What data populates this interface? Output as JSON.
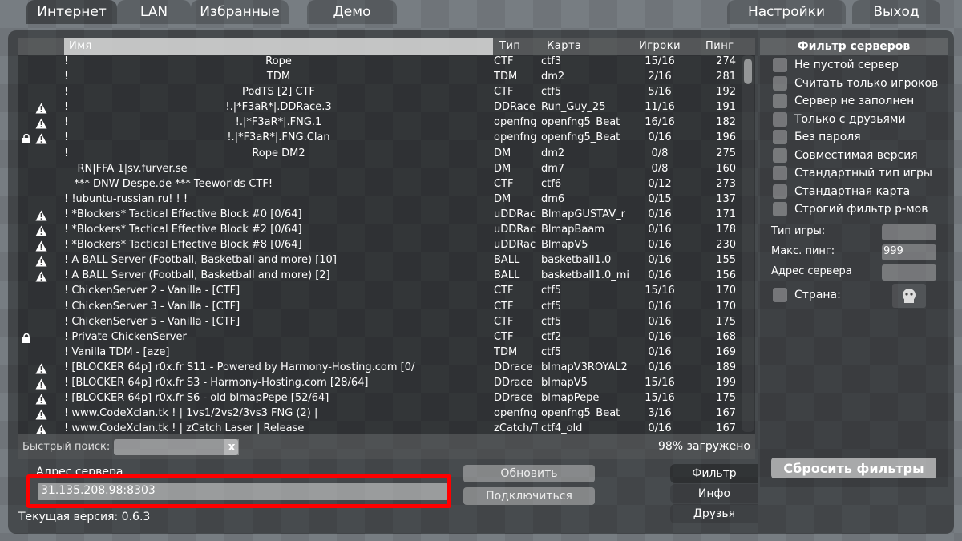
{
  "tabs": {
    "internet": "Интернет",
    "lan": "LAN",
    "favorites": "Избранные",
    "demo": "Демо",
    "settings": "Настройки",
    "quit": "Выход"
  },
  "columns": {
    "name": "Имя",
    "type": "Тип",
    "map": "Карта",
    "players": "Игроки",
    "ping": "Пинг"
  },
  "servers": [
    {
      "name": "Rope",
      "center": true,
      "type": "CTF",
      "map": "ctf3",
      "players": "15/16",
      "ping": "274",
      "lock": false,
      "warn": false
    },
    {
      "name": "TDM",
      "center": true,
      "type": "TDM",
      "map": "dm2",
      "players": "2/16",
      "ping": "281",
      "lock": false,
      "warn": false
    },
    {
      "name": "PodTS [2] CTF",
      "center": true,
      "type": "CTF",
      "map": "ctf5",
      "players": "5/16",
      "ping": "192",
      "lock": false,
      "warn": false
    },
    {
      "name": "!.|*F3aR*|.DDRace.3",
      "center": true,
      "type": "DDRace",
      "map": "Run_Guy_25",
      "players": "11/16",
      "ping": "191",
      "lock": false,
      "warn": true
    },
    {
      "name": "!.|*F3aR*|.FNG.1",
      "center": true,
      "type": "openfng",
      "map": "openfng5_Beat",
      "players": "16/16",
      "ping": "182",
      "lock": false,
      "warn": true
    },
    {
      "name": "!.|*F3aR*|.FNG.Clan",
      "center": true,
      "type": "openfng",
      "map": "openfng5_Beat",
      "players": "0/16",
      "ping": "196",
      "lock": true,
      "warn": true
    },
    {
      "name": "Rope DM2",
      "center": true,
      "type": "DM",
      "map": "dm2",
      "players": "0/8",
      "ping": "275",
      "lock": false,
      "warn": false
    },
    {
      "name": "    RN|FFA 1|sv.furver.se",
      "center": false,
      "type": "DM",
      "map": "dm7",
      "players": "0/8",
      "ping": "160",
      "lock": false,
      "warn": false
    },
    {
      "name": "   *** DNW Despe.de *** Teeworlds CTF!",
      "center": false,
      "type": "CTF",
      "map": "ctf6",
      "players": "0/12",
      "ping": "273",
      "lock": false,
      "warn": false
    },
    {
      "name": "! !ubuntu-russian.ru! ! !",
      "center": false,
      "type": "DM",
      "map": "dm6",
      "players": "0/15",
      "ping": "137",
      "lock": false,
      "warn": false
    },
    {
      "name": "! *Blockers* Tactical Effective Block #0 [0/64]",
      "center": false,
      "type": "uDDRac",
      "map": "BlmapGUSTAV_r",
      "players": "0/16",
      "ping": "171",
      "lock": false,
      "warn": true
    },
    {
      "name": "! *Blockers* Tactical Effective Block #2 [0/64]",
      "center": false,
      "type": "uDDRac",
      "map": "BlmapBaam",
      "players": "0/16",
      "ping": "178",
      "lock": false,
      "warn": true
    },
    {
      "name": "! *Blockers* Tactical Effective Block #8 [0/64]",
      "center": false,
      "type": "uDDRac",
      "map": "BlmapV5",
      "players": "0/16",
      "ping": "230",
      "lock": false,
      "warn": true
    },
    {
      "name": "! A BALL Server (Football, Basketball and more) [10]",
      "center": false,
      "type": "BALL",
      "map": "basketball1.0",
      "players": "0/16",
      "ping": "155",
      "lock": false,
      "warn": true
    },
    {
      "name": "! A BALL Server (Football, Basketball and more) [2]",
      "center": false,
      "type": "BALL",
      "map": "basketball1.0_mi",
      "players": "0/16",
      "ping": "156",
      "lock": false,
      "warn": true
    },
    {
      "name": "! ChickenServer 2 - Vanilla - [CTF]",
      "center": false,
      "type": "CTF",
      "map": "ctf5",
      "players": "15/16",
      "ping": "170",
      "lock": false,
      "warn": false
    },
    {
      "name": "! ChickenServer 3 - Vanilla - [CTF]",
      "center": false,
      "type": "CTF",
      "map": "ctf5",
      "players": "0/16",
      "ping": "170",
      "lock": false,
      "warn": false
    },
    {
      "name": "! ChickenServer 5 - Vanilla - [CTF]",
      "center": false,
      "type": "CTF",
      "map": "ctf5",
      "players": "0/16",
      "ping": "175",
      "lock": false,
      "warn": false
    },
    {
      "name": "! Private ChickenServer",
      "center": false,
      "type": "CTF",
      "map": "ctf2",
      "players": "0/16",
      "ping": "168",
      "lock": true,
      "warn": false
    },
    {
      "name": "! Vanilla TDM - [aze]",
      "center": false,
      "type": "TDM",
      "map": "ctf5",
      "players": "0/16",
      "ping": "169",
      "lock": false,
      "warn": false
    },
    {
      "name": "! [BLOCKER 64p] r0x.fr S11 - Powered by Harmony-Hosting.com [0/",
      "center": false,
      "type": "DDrace",
      "map": "blmapV3ROYAL2",
      "players": "0/16",
      "ping": "189",
      "lock": false,
      "warn": true
    },
    {
      "name": "! [BLOCKER 64p] r0x.fr S3 - Harmony-Hosting.com [28/64]",
      "center": false,
      "type": "DDrace",
      "map": "blmapV5",
      "players": "15/16",
      "ping": "199",
      "lock": false,
      "warn": true
    },
    {
      "name": "! [BLOCKER 64p] r0x.fr S6 - old blmapPepe [52/64]",
      "center": false,
      "type": "DDrace",
      "map": "blmapPepe",
      "players": "15/16",
      "ping": "175",
      "lock": false,
      "warn": true
    },
    {
      "name": "! www.CodeXclan.tk ! | 1vs1/2vs2/3vs3 FNG (2) |",
      "center": false,
      "type": "openfng",
      "map": "openfng5_Beat",
      "players": "3/16",
      "ping": "167",
      "lock": false,
      "warn": true
    },
    {
      "name": "! www.CodeXclan.tk ! | zCatch Laser | Release",
      "center": false,
      "type": "zCatch/T",
      "map": "ctf4_old",
      "players": "0/16",
      "ping": "167",
      "lock": false,
      "warn": true
    }
  ],
  "search": {
    "label": "Быстрый поиск:",
    "value": "",
    "clear": "x"
  },
  "loaded": "98% загружено",
  "filters": {
    "title": "Фильтр серверов",
    "checks": [
      "Не пустой сервер",
      "Считать только игроков",
      "Сервер не заполнен",
      "Только с друзьями",
      "Без пароля",
      "Совместимая версия",
      "Стандартный тип игры",
      "Стандартная карта",
      "Строгий фильтр р-мов"
    ],
    "game_type_label": "Тип игры:",
    "game_type_value": "",
    "max_ping_label": "Макс. пинг:",
    "max_ping_value": "999",
    "server_addr_label": "Адрес сервера",
    "server_addr_value": "",
    "country_label": "Страна:",
    "reset": "Сбросить фильтры"
  },
  "address": {
    "label": "Адрес сервера",
    "value": "31.135.208.98:8303"
  },
  "buttons": {
    "refresh": "Обновить",
    "connect": "Подключиться"
  },
  "sidetabs": {
    "filter": "Фильтр",
    "info": "Инфо",
    "friends": "Друзья"
  },
  "version": "Текущая версия: 0.6.3",
  "colors": {
    "highlight": "#ff0000"
  }
}
